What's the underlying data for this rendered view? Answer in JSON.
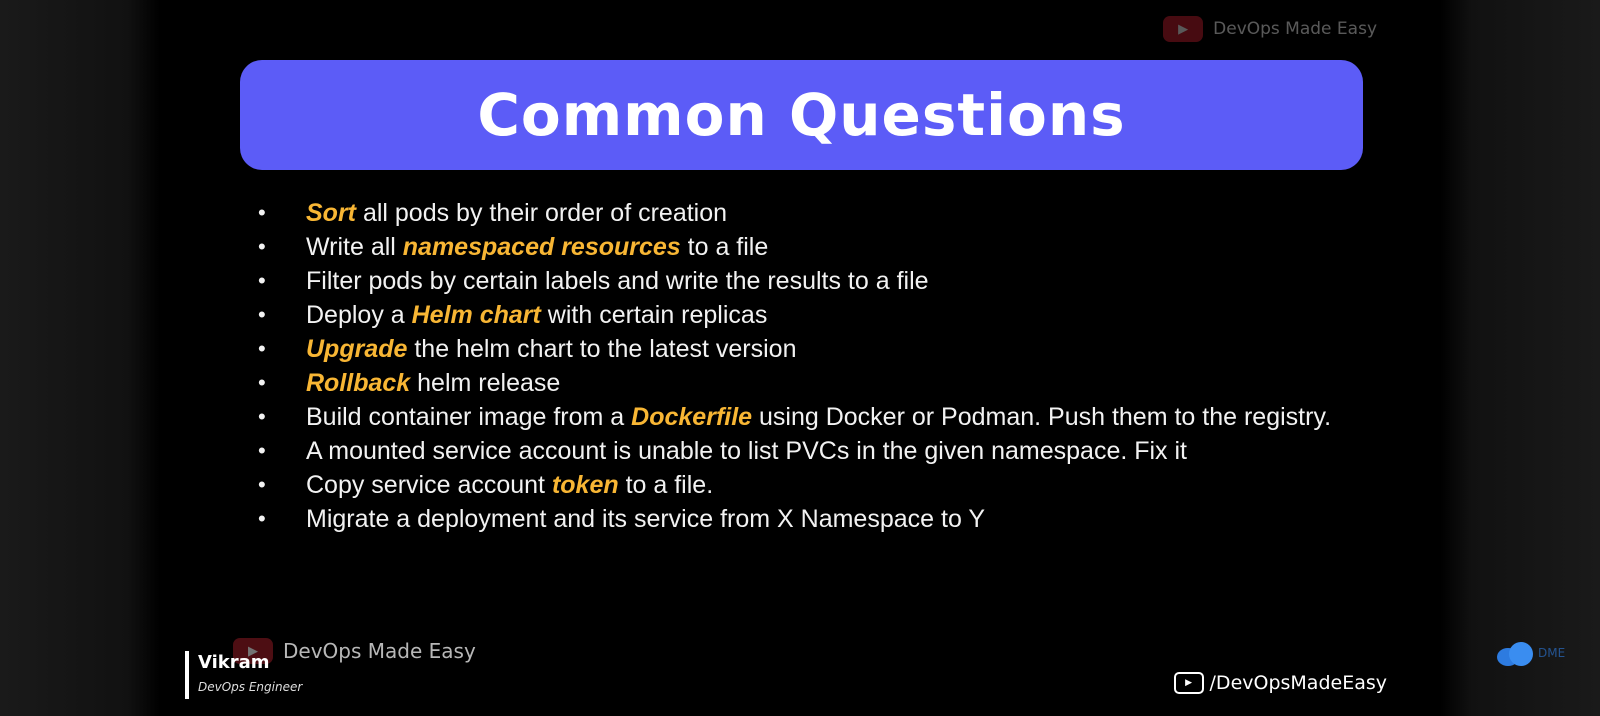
{
  "slide": {
    "title": "Common Questions",
    "watermark_top": "DevOps Made Easy",
    "bullets": [
      {
        "parts": [
          {
            "text": "Sort",
            "hl": true
          },
          {
            "text": " all pods by their order of creation"
          }
        ]
      },
      {
        "parts": [
          {
            "text": "Write all "
          },
          {
            "text": "namespaced resources",
            "hl": true
          },
          {
            "text": " to a file"
          }
        ]
      },
      {
        "parts": [
          {
            "text": "Filter pods by certain labels and write the results to a file"
          }
        ]
      },
      {
        "parts": [
          {
            "text": "Deploy a "
          },
          {
            "text": "Helm chart",
            "hl": true
          },
          {
            "text": " with certain replicas"
          }
        ]
      },
      {
        "parts": [
          {
            "text": "Upgrade",
            "hl": true
          },
          {
            "text": " the helm chart to the latest version"
          }
        ]
      },
      {
        "parts": [
          {
            "text": "Rollback",
            "hl": true
          },
          {
            "text": " helm release"
          }
        ]
      },
      {
        "parts": [
          {
            "text": "Build container  image from a "
          },
          {
            "text": "Dockerfile",
            "hl": true
          },
          {
            "text": " using Docker or Podman. Push them to the registry."
          }
        ]
      },
      {
        "parts": [
          {
            "text": "A mounted service account is unable to list PVCs in the given namespace. Fix it"
          }
        ]
      },
      {
        "parts": [
          {
            "text": "Copy  service account "
          },
          {
            "text": "token",
            "hl": true
          },
          {
            "text": " to a file."
          }
        ]
      },
      {
        "parts": [
          {
            "text": "Migrate  a deployment and its service from X Namespace to Y"
          }
        ]
      }
    ]
  },
  "presenter": {
    "name": "Vikram",
    "role": "DevOps Engineer"
  },
  "watermark_bottom": "DevOps Made Easy",
  "channel_handle": "/DevOpsMadeEasy",
  "cloud_label": "DME",
  "colors": {
    "banner": "#5c5cf7",
    "highlight": "#f8b634",
    "background": "#000000"
  },
  "icons": [
    "youtube-play-icon",
    "cloud-logo-icon"
  ]
}
